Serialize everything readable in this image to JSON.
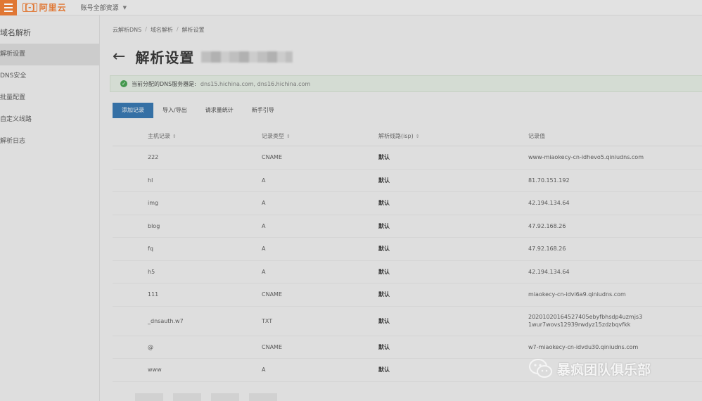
{
  "topbar": {
    "logo_text": "阿里云",
    "account_label": "账号全部资源"
  },
  "sidebar": {
    "title": "域名解析",
    "items": [
      {
        "label": "解析设置",
        "active": true
      },
      {
        "label": "DNS安全"
      },
      {
        "label": "批量配置"
      },
      {
        "label": "自定义线路"
      },
      {
        "label": "解析日志"
      }
    ]
  },
  "breadcrumb": [
    "云解析DNS",
    "域名解析",
    "解析设置"
  ],
  "page_title": "解析设置",
  "notice": {
    "label": "当前分配的DNS服务器是:",
    "servers": "dns15.hichina.com, dns16.hichina.com"
  },
  "toolbar": {
    "add_record": "添加记录",
    "import_export": "导入/导出",
    "request_stats": "请求量统计",
    "guide": "新手引导"
  },
  "table": {
    "headers": {
      "host": "主机记录",
      "type": "记录类型",
      "line": "解析线路(isp)",
      "value": "记录值"
    },
    "rows": [
      {
        "host": "222",
        "type": "CNAME",
        "line": "默认",
        "value": "www-miaokecy-cn-idhevo5.qiniudns.com"
      },
      {
        "host": "hl",
        "type": "A",
        "line": "默认",
        "value": "81.70.151.192"
      },
      {
        "host": "img",
        "type": "A",
        "line": "默认",
        "value": "42.194.134.64"
      },
      {
        "host": "blog",
        "type": "A",
        "line": "默认",
        "value": "47.92.168.26"
      },
      {
        "host": "fq",
        "type": "A",
        "line": "默认",
        "value": "47.92.168.26"
      },
      {
        "host": "h5",
        "type": "A",
        "line": "默认",
        "value": "42.194.134.64"
      },
      {
        "host": "111",
        "type": "CNAME",
        "line": "默认",
        "value": "miaokecy-cn-idvi6a9.qiniudns.com"
      },
      {
        "host": "_dnsauth.w7",
        "type": "TXT",
        "line": "默认",
        "value": "20201020164527405ebyfbhsdp4uzmjs31wur7wovs12939rwdyz15zdzbqvfkk"
      },
      {
        "host": "@",
        "type": "CNAME",
        "line": "默认",
        "value": "w7-miaokecy-cn-idvdu30.qiniudns.com"
      },
      {
        "host": "www",
        "type": "A",
        "line": "默认",
        "value": ""
      }
    ]
  },
  "watermark": {
    "text": "暴疯团队俱乐部"
  },
  "colors": {
    "brand": "#e8762d",
    "primary_button": "#2e6fa8",
    "success": "#3f9a4a"
  }
}
